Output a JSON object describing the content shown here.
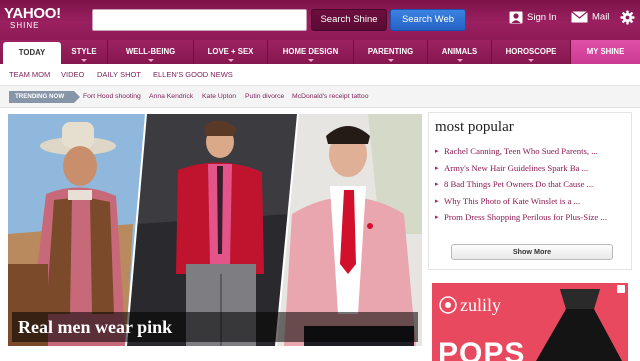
{
  "header": {
    "logo_main": "YAHOO!",
    "logo_sub": "SHINE",
    "search_placeholder": "",
    "search_shine_label": "Search Shine",
    "search_web_label": "Search Web",
    "signin_label": "Sign In",
    "mail_label": "Mail"
  },
  "nav": {
    "items": [
      {
        "label": "TODAY"
      },
      {
        "label": "STYLE"
      },
      {
        "label": "WELL-BEING"
      },
      {
        "label": "LOVE + SEX"
      },
      {
        "label": "HOME DESIGN"
      },
      {
        "label": "PARENTING"
      },
      {
        "label": "ANIMALS"
      },
      {
        "label": "HOROSCOPE"
      },
      {
        "label": "MY SHINE"
      }
    ]
  },
  "subnav": {
    "items": [
      {
        "label": "TEAM MOM"
      },
      {
        "label": "VIDEO"
      },
      {
        "label": "DAILY SHOT"
      },
      {
        "label": "ELLEN'S GOOD NEWS"
      }
    ]
  },
  "trending": {
    "label": "TRENDING NOW",
    "items": [
      {
        "label": "Fort Hood shooting"
      },
      {
        "label": "Anna Kendrick"
      },
      {
        "label": "Kate Upton"
      },
      {
        "label": "Putin divorce"
      },
      {
        "label": "McDonald's receipt tattoo"
      }
    ]
  },
  "hero": {
    "title": "Real men wear pink"
  },
  "popular": {
    "title": "most popular",
    "items": [
      {
        "label": "Rachel Canning, Teen Who Sued Parents, ..."
      },
      {
        "label": "Army's New Hair Guidelines Spark Ba ..."
      },
      {
        "label": "8 Bad Things Pet Owners Do that Cause ..."
      },
      {
        "label": "Why This Photo of Kate Winslet is a ..."
      },
      {
        "label": "Prom Dress Shopping Perilous for Plus-Size ..."
      }
    ],
    "show_more_label": "Show More"
  },
  "ad": {
    "brand": "zulily",
    "headline": "POPS"
  },
  "colors": {
    "brand": "#8f1a58",
    "nav_active": "#ffffff",
    "myshine": "#d8449e",
    "search_web": "#2f72d6",
    "link": "#8a1a52"
  }
}
